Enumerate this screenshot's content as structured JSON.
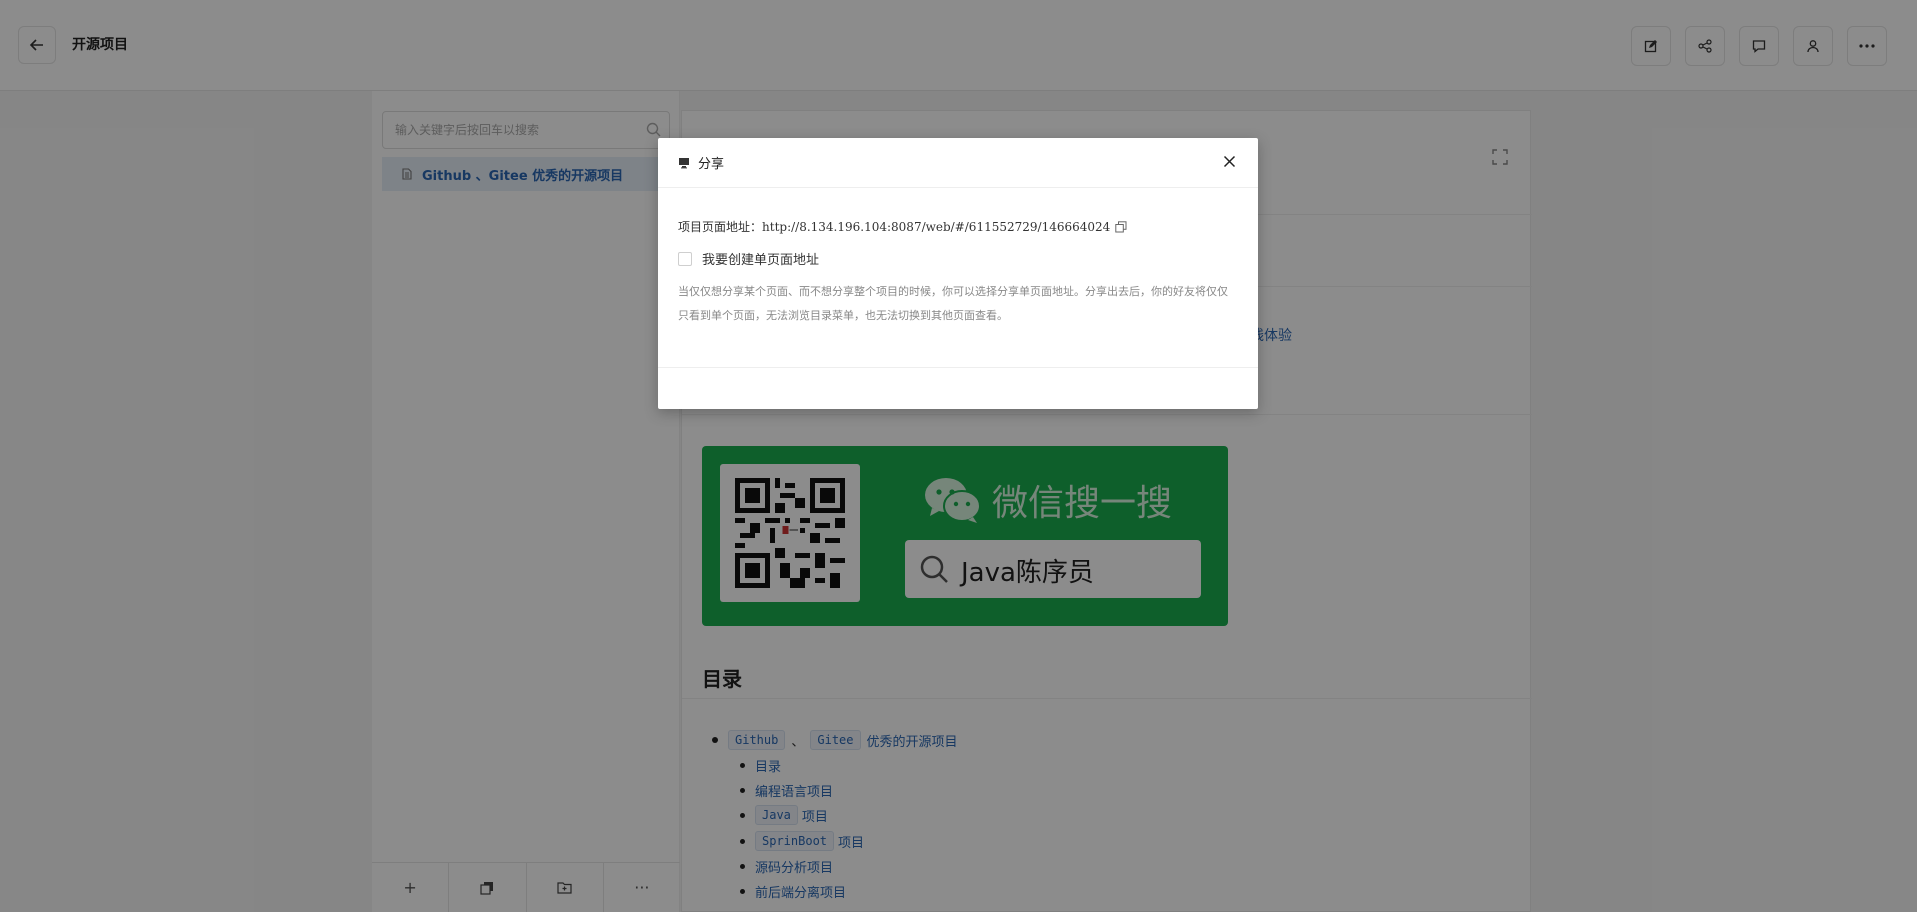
{
  "header": {
    "title": "开源项目"
  },
  "sidebar": {
    "search_placeholder": "输入关键字后按回车以搜索",
    "tree_item": "Github 、Gitee 优秀的开源项目",
    "footer_plus": "+",
    "footer_more": "···"
  },
  "main": {
    "link_fragment": "线体验",
    "promo": {
      "title": "微信搜一搜",
      "search_text": "Java陈序员"
    },
    "toc_heading": "目录",
    "toc": {
      "top": {
        "code1": "Github",
        "sep": "、",
        "code2": "Gitee",
        "text": "优秀的开源项目"
      },
      "items": [
        {
          "text": "目录"
        },
        {
          "text": "编程语言项目"
        },
        {
          "code": "Java",
          "text": "项目"
        },
        {
          "code": "SprinBoot",
          "text": "项目"
        },
        {
          "text": "源码分析项目"
        },
        {
          "text": "前后端分离项目"
        }
      ]
    }
  },
  "modal": {
    "title": "分享",
    "url_label": "项目页面地址：",
    "url_value": "http://8.134.196.104:8087/web/#/611552729/146664024",
    "checkbox_label": "我要创建单页面地址",
    "hint": "当仅仅想分享某个页面、而不想分享整个项目的时候，你可以选择分享单页面地址。分享出去后，你的好友将仅仅只看到单个页面，无法浏览目录菜单，也无法切换到其他页面查看。"
  }
}
